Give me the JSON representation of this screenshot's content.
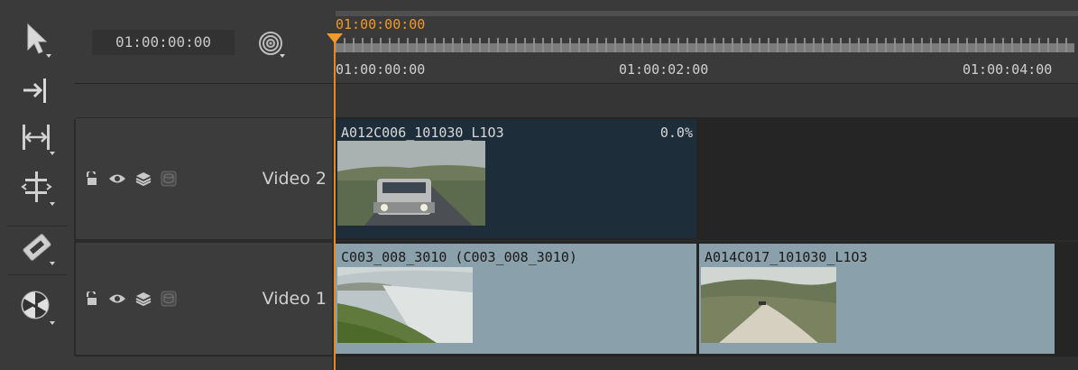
{
  "toolbar": {
    "tools": [
      {
        "name": "select",
        "icon": "arrow-pointer-icon"
      },
      {
        "name": "slip",
        "icon": "arrow-to-line-icon"
      },
      {
        "name": "trim",
        "icon": "horizontal-stretch-icon"
      },
      {
        "name": "stack",
        "icon": "vertical-trim-icon"
      },
      {
        "name": "razor",
        "icon": "razor-blade-icon"
      },
      {
        "name": "radioactive",
        "icon": "radioactive-icon"
      }
    ]
  },
  "header": {
    "timecode": "01:00:00:00",
    "target_icon": "target-icon"
  },
  "ruler": {
    "playhead_timecode": "01:00:00:00",
    "labels": [
      "01:00:00:00",
      "01:00:02:00",
      "01:00:04:00"
    ]
  },
  "tracks": [
    {
      "name": "Video 2",
      "icons": [
        "lock-icon",
        "eye-icon",
        "layers-icon",
        "database-icon"
      ]
    },
    {
      "name": "Video 1",
      "icons": [
        "lock-icon",
        "eye-icon",
        "layers-icon",
        "database-icon"
      ]
    }
  ],
  "clips": {
    "video2": [
      {
        "title": "A012C006_101030_L1O3",
        "progress": "0.0%",
        "color": "#1e2d3a",
        "title_color": "#d8d8d8"
      }
    ],
    "video1": [
      {
        "title": "C003_008_3010 (C003_008_3010)",
        "color": "#8aa0aa",
        "title_color": "#1a1a1a"
      },
      {
        "title": "A014C017_101030_L1O3",
        "color": "#8aa0aa",
        "title_color": "#1a1a1a"
      }
    ]
  },
  "colors": {
    "playhead": "#e8891f",
    "panel": "#3a3a3a",
    "lane": "#252525"
  }
}
